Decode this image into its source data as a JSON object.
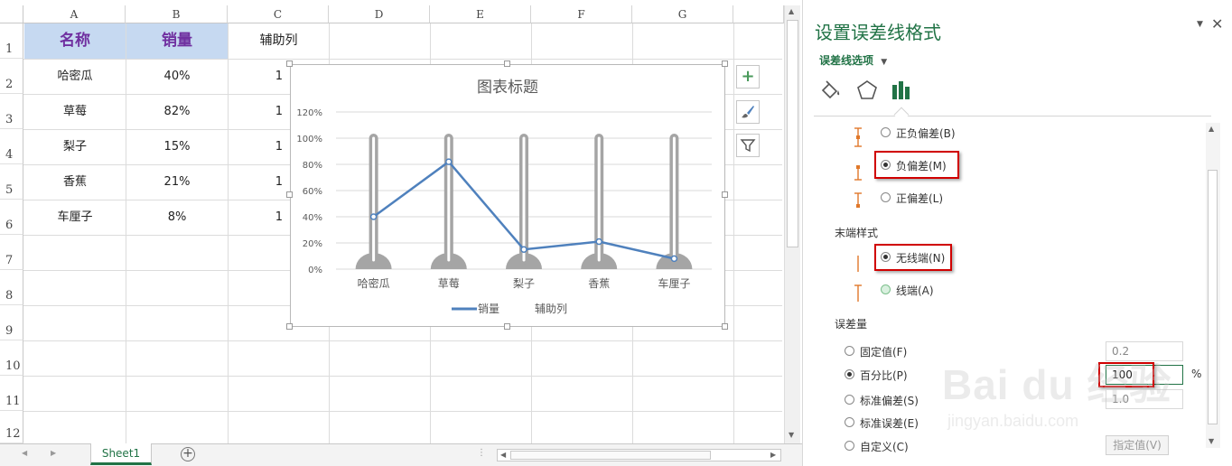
{
  "sheet": {
    "columns": [
      "A",
      "B",
      "C",
      "D",
      "E",
      "F",
      "G"
    ],
    "rows": [
      "1",
      "2",
      "3",
      "4",
      "5",
      "6",
      "7",
      "8",
      "9",
      "10",
      "11",
      "12"
    ],
    "header": {
      "a": "名称",
      "b": "销量",
      "c": "辅助列"
    },
    "data": [
      {
        "name": "哈密瓜",
        "sales": "40%",
        "aux": "1"
      },
      {
        "name": "草莓",
        "sales": "82%",
        "aux": "1"
      },
      {
        "name": "梨子",
        "sales": "15%",
        "aux": "1"
      },
      {
        "name": "香蕉",
        "sales": "21%",
        "aux": "1"
      },
      {
        "name": "车厘子",
        "sales": "8%",
        "aux": "1"
      }
    ],
    "tab": "Sheet1",
    "add_sheet_icon": "plus-circle-icon"
  },
  "chart_data": {
    "type": "line",
    "title": "图表标题",
    "categories": [
      "哈密瓜",
      "草莓",
      "梨子",
      "香蕉",
      "车厘子"
    ],
    "series": [
      {
        "name": "销量",
        "values": [
          0.4,
          0.82,
          0.15,
          0.21,
          0.08
        ],
        "color": "#4f81bd"
      },
      {
        "name": "辅助列",
        "values": [
          1,
          1,
          1,
          1,
          1
        ],
        "color": "#a5a5a5"
      }
    ],
    "yticks": [
      "0%",
      "20%",
      "40%",
      "60%",
      "80%",
      "100%",
      "120%"
    ],
    "ylim": [
      0,
      1.2
    ],
    "grid": true,
    "legend": "bottom"
  },
  "chart_buttons": {
    "add": "+",
    "style": "brush-icon",
    "filter": "filter-icon"
  },
  "pane": {
    "title": "设置误差线格式",
    "dropdown": "误差线选项",
    "icons": [
      "fill-line-icon",
      "pentagon-effects-icon",
      "bar-chart-options-icon"
    ],
    "direction": {
      "both": "正负偏差(B)",
      "minus": "负偏差(M)",
      "plus": "正偏差(L)"
    },
    "end_style": {
      "heading": "末端样式",
      "nocap": "无线端(N)",
      "cap": "线端(A)"
    },
    "amount": {
      "heading": "误差量",
      "fixed": "固定值(F)",
      "fixed_value": "0.2",
      "percentage": "百分比(P)",
      "percentage_value": "100",
      "percent_sign": "%",
      "stddev": "标准偏差(S)",
      "stddev_value": "1.0",
      "stderr": "标准误差(E)",
      "custom": "自定义(C)",
      "specify": "指定值(V)"
    },
    "watermark": {
      "brand": "Bai du 经验",
      "url": "jingyan.baidu.com"
    }
  }
}
